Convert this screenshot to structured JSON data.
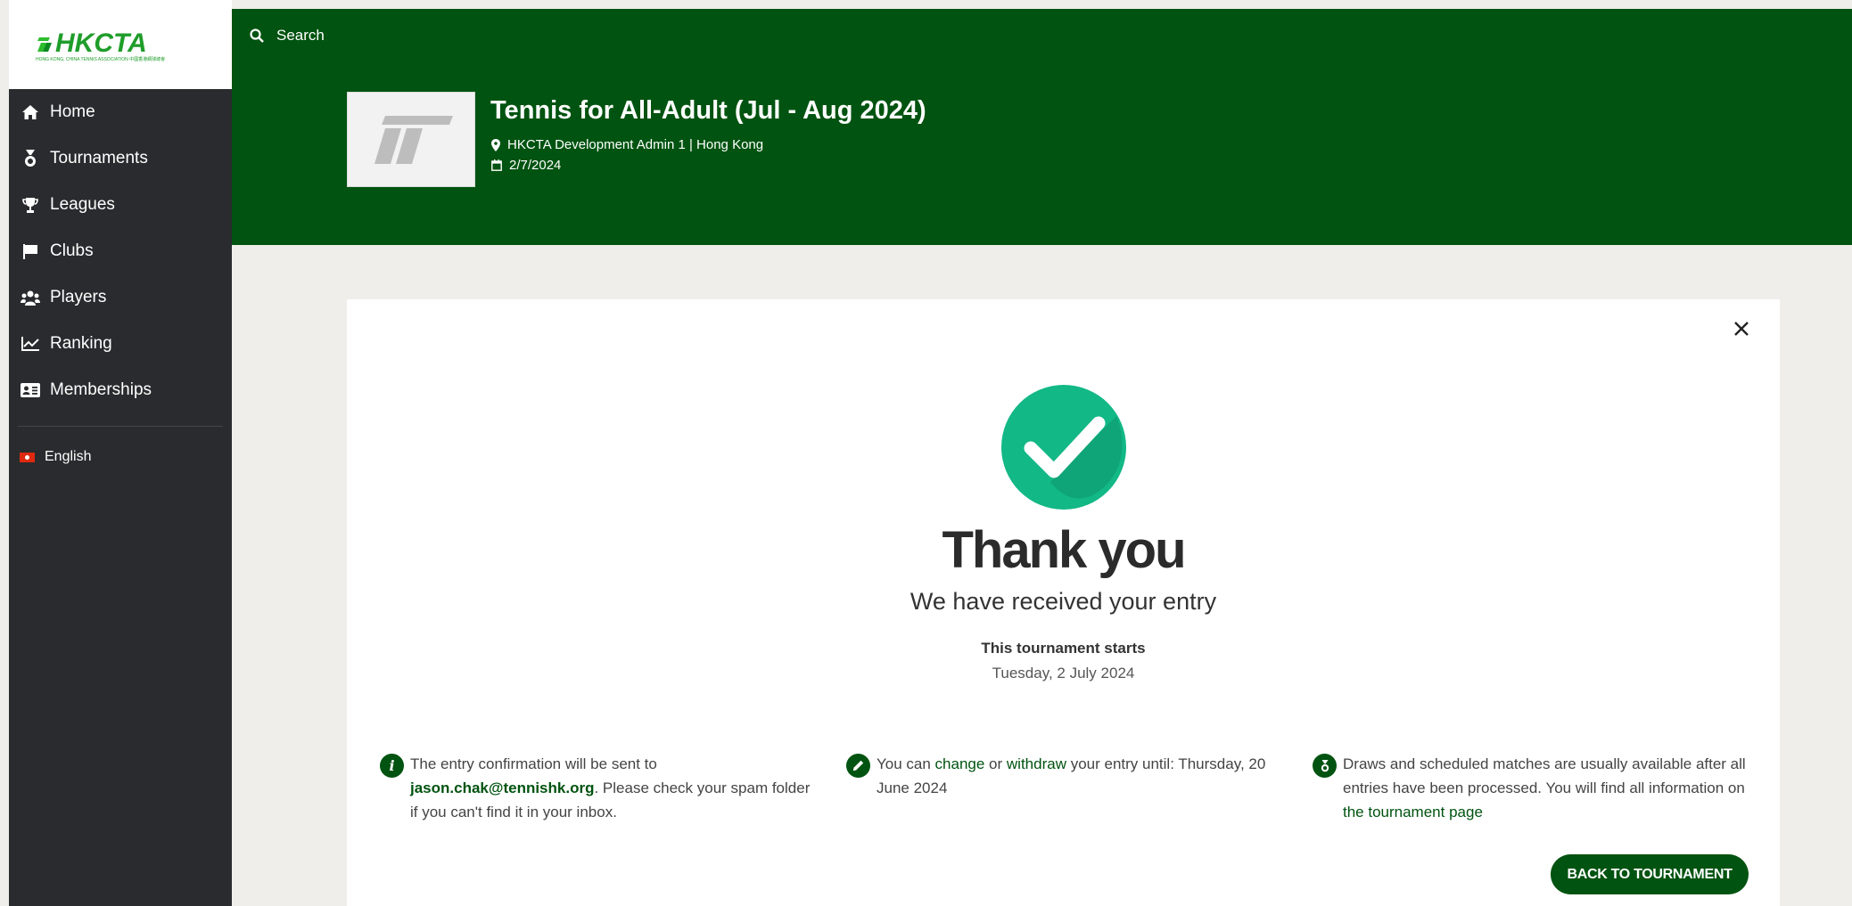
{
  "brand": {
    "logo_text": "HKCTA",
    "logo_subtext": "HONG KONG, CHINA TENNIS ASSOCIATION 中國香港網球總會",
    "primary_color": "#005310",
    "sidebar_color": "#2a2b2e"
  },
  "sidebar": {
    "items": [
      {
        "label": "Home",
        "icon": "home-icon"
      },
      {
        "label": "Tournaments",
        "icon": "medal-icon"
      },
      {
        "label": "Leagues",
        "icon": "trophy-icon"
      },
      {
        "label": "Clubs",
        "icon": "flag-icon"
      },
      {
        "label": "Players",
        "icon": "users-icon"
      },
      {
        "label": "Ranking",
        "icon": "chart-line-icon"
      },
      {
        "label": "Memberships",
        "icon": "id-card-icon"
      }
    ],
    "language": {
      "label": "English",
      "icon": "hk-flag-icon"
    }
  },
  "header": {
    "search_label": "Search",
    "tournament_title": "Tennis for All-Adult (Jul - Aug 2024)",
    "location": "HKCTA Development Admin 1 | Hong Kong",
    "date": "2/7/2024"
  },
  "confirmation": {
    "heading": "Thank you",
    "subheading": "We have received your entry",
    "starts_label": "This tournament starts",
    "starts_date": "Tuesday, 2 July 2024",
    "info1": {
      "prefix": "The entry confirmation will be sent to ",
      "email": "jason.chak@tennishk.org",
      "suffix": ". Please check your spam folder if you can't find it in your inbox."
    },
    "info2": {
      "prefix": "You can ",
      "change": "change",
      "mid": " or ",
      "withdraw": "withdraw",
      "suffix": " your entry until: Thursday, 20 June 2024"
    },
    "info3": {
      "prefix": "Draws and scheduled matches are usually available after all entries have been processed. You will find all information on ",
      "link": "the tournament page"
    },
    "back_button": "BACK TO TOURNAMENT",
    "success_color": "#12b886"
  }
}
